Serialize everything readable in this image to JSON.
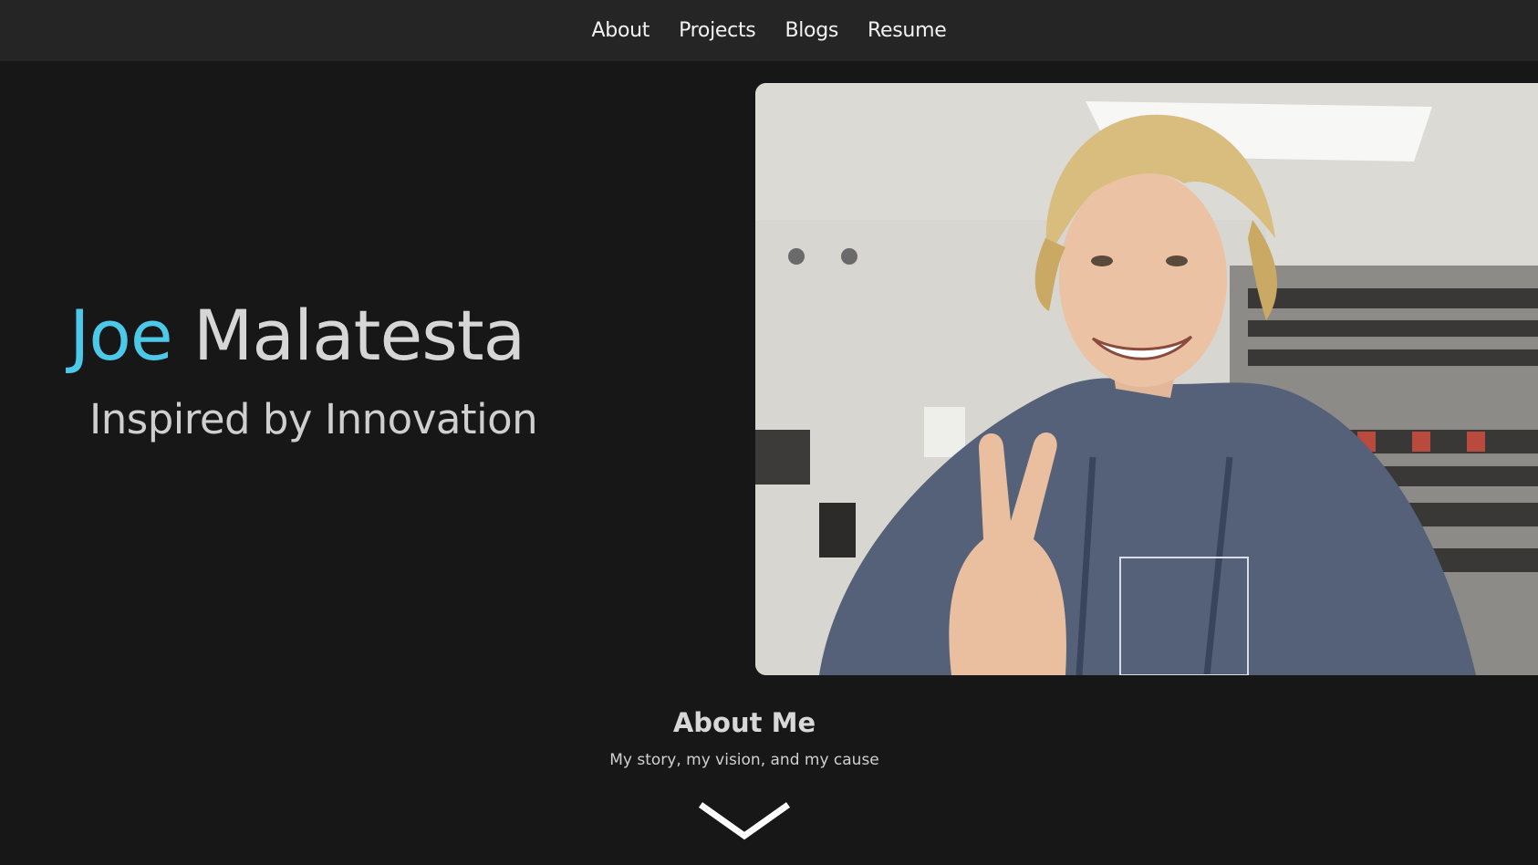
{
  "nav": {
    "items": [
      {
        "label": "About"
      },
      {
        "label": "Projects"
      },
      {
        "label": "Blogs"
      },
      {
        "label": "Resume"
      }
    ]
  },
  "hero": {
    "first_name": "Joe",
    "last_name": "Malatesta",
    "tagline": "Inspired by Innovation",
    "photo_alt": ""
  },
  "about": {
    "title": "About Me",
    "subtitle": "My story, my vision, and my cause",
    "scroll_icon": "chevron-down-icon"
  },
  "colors": {
    "background": "#171718",
    "navbar": "#252526",
    "accent": "#4cc9e8",
    "text": "#d6d6d6"
  }
}
